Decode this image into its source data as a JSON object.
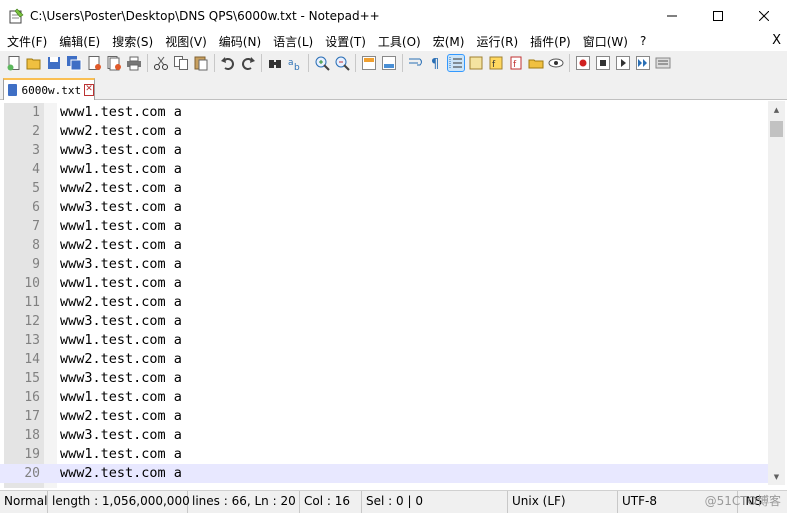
{
  "window": {
    "title": "C:\\Users\\Poster\\Desktop\\DNS QPS\\6000w.txt - Notepad++"
  },
  "menu": {
    "items": [
      "文件(F)",
      "编辑(E)",
      "搜索(S)",
      "视图(V)",
      "编码(N)",
      "语言(L)",
      "设置(T)",
      "工具(O)",
      "宏(M)",
      "运行(R)",
      "插件(P)",
      "窗口(W)",
      "?"
    ],
    "close": "X"
  },
  "toolbar": {
    "icons": [
      "new-file-icon",
      "open-file-icon",
      "save-icon",
      "save-all-icon",
      "close-icon",
      "close-all-icon",
      "print-icon",
      "cut-icon",
      "copy-icon",
      "paste-icon",
      "undo-icon",
      "redo-icon",
      "find-icon",
      "replace-icon",
      "zoom-in-icon",
      "zoom-out-icon",
      "sync-vertical-icon",
      "sync-horizontal-icon",
      "word-wrap-icon",
      "show-all-chars-icon",
      "indent-guide-icon",
      "document-map-icon",
      "function-list-icon",
      "folder-workspace-icon",
      "monitoring-icon",
      "record-macro-icon",
      "stop-macro-icon",
      "play-macro-icon",
      "run-macro-multiple-icon",
      "save-macro-icon"
    ]
  },
  "tab": {
    "label": "6000w.txt"
  },
  "editor": {
    "lines": [
      {
        "num": "1",
        "text": "www1.test.com a"
      },
      {
        "num": "2",
        "text": "www2.test.com a"
      },
      {
        "num": "3",
        "text": "www3.test.com a"
      },
      {
        "num": "4",
        "text": "www1.test.com a"
      },
      {
        "num": "5",
        "text": "www2.test.com a"
      },
      {
        "num": "6",
        "text": "www3.test.com a"
      },
      {
        "num": "7",
        "text": "www1.test.com a"
      },
      {
        "num": "8",
        "text": "www2.test.com a"
      },
      {
        "num": "9",
        "text": "www3.test.com a"
      },
      {
        "num": "10",
        "text": "www1.test.com a"
      },
      {
        "num": "11",
        "text": "www2.test.com a"
      },
      {
        "num": "12",
        "text": "www3.test.com a"
      },
      {
        "num": "13",
        "text": "www1.test.com a"
      },
      {
        "num": "14",
        "text": "www2.test.com a"
      },
      {
        "num": "15",
        "text": "www3.test.com a"
      },
      {
        "num": "16",
        "text": "www1.test.com a"
      },
      {
        "num": "17",
        "text": "www2.test.com a"
      },
      {
        "num": "18",
        "text": "www3.test.com a"
      },
      {
        "num": "19",
        "text": "www1.test.com a"
      },
      {
        "num": "20",
        "text": "www2.test.com a"
      }
    ],
    "current_line": 20
  },
  "status": {
    "mode": "Normal",
    "length": "length : 1,056,000,000",
    "lines": "lines : 66, Ln : 20",
    "col": "Col : 16",
    "sel": "Sel : 0 | 0",
    "eol": "Unix (LF)",
    "encoding": "UTF-8",
    "ins": "INS",
    "watermark": "@51CTO博客"
  },
  "colors": {
    "gutter": "#e4e4e4",
    "current_line": "#e8e8ff",
    "tab_accent": "#fabf53",
    "line_number": "#808080"
  }
}
